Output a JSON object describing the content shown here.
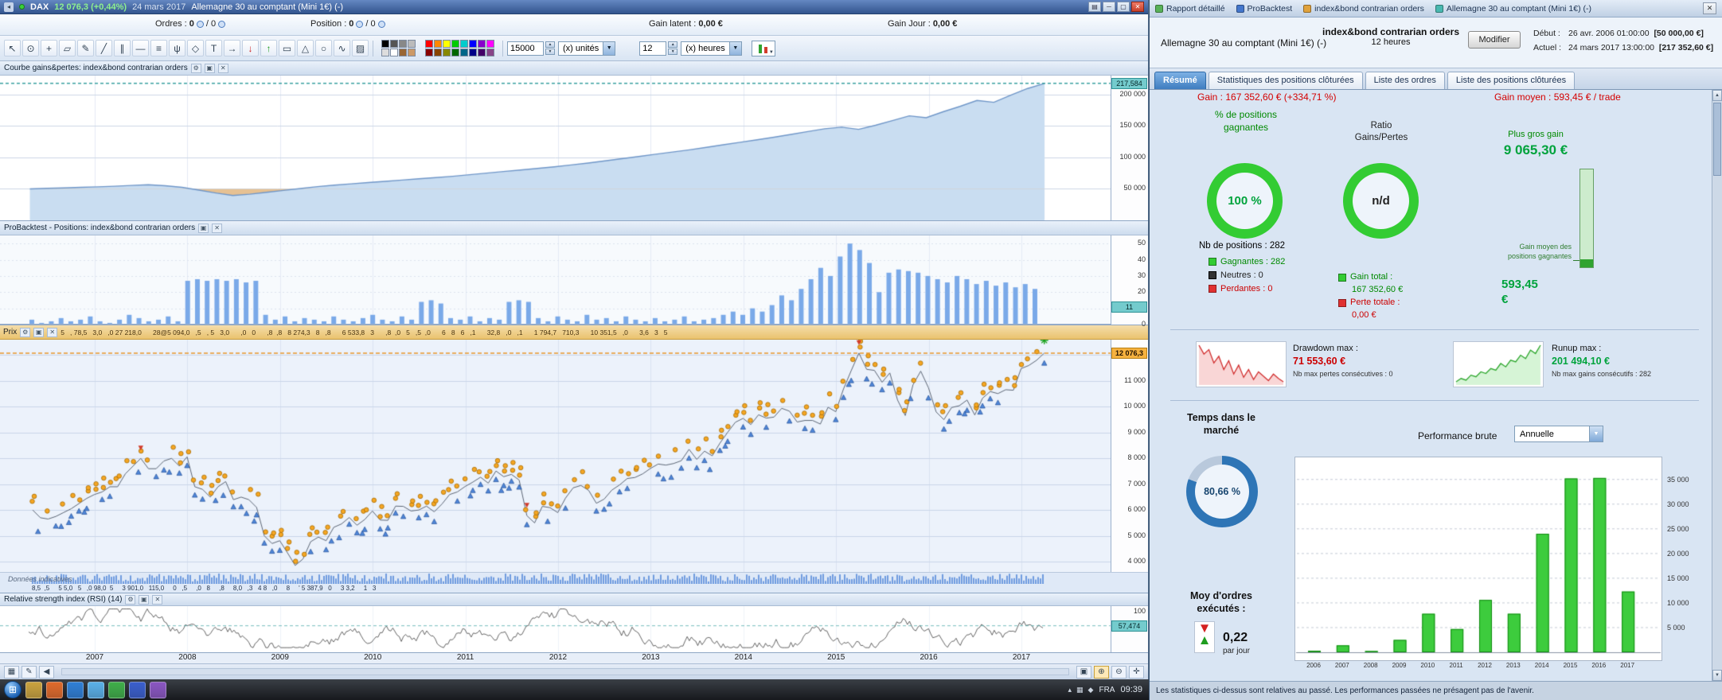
{
  "colors": {
    "equity_fill": "#c9ddf1",
    "equity_line": "#6f96c8",
    "equity_dip_fill": "#e6c193",
    "bar_blue": "#7aa9e8",
    "price_line": "#5c6675",
    "marker_orange": "#f5a623",
    "marker_blue": "#4f86d8",
    "perf_bar_fill": "#3dcc3d",
    "perf_bar_edge": "#0f8a0f",
    "donut_green": "#33cc33",
    "donut_blue": "#2e75b6",
    "teal_box": "#74cbcd",
    "orange_box": "#f6b23f"
  },
  "chart_window": {
    "title_bar": {
      "symbol": "DAX",
      "price": "12 076,3 (+0,44%)",
      "date": "24 mars 2017",
      "instrument": "Allemagne 30 au comptant (Mini 1€) (-)"
    },
    "info_bar": {
      "orders_label": "Ordres :",
      "orders_a": "0",
      "orders_b": "/ 0",
      "position_label": "Position :",
      "position_a": "0",
      "position_b": "/ 0",
      "gain_latent_label": "Gain latent :",
      "gain_latent_value": "0,00 €",
      "gain_jour_label": "Gain Jour :",
      "gain_jour_value": "0,00 €"
    },
    "toolbar": {
      "icons": [
        {
          "glyph": "↖",
          "name": "cursor-icon"
        },
        {
          "glyph": "⊙",
          "name": "zoom-icon"
        },
        {
          "glyph": "+",
          "name": "crosshair-icon"
        },
        {
          "glyph": "▱",
          "name": "eraser-icon"
        },
        {
          "glyph": "✎",
          "name": "pencil-icon"
        },
        {
          "glyph": "╱",
          "name": "line-icon"
        },
        {
          "glyph": "∥",
          "name": "parallel-lines-icon"
        },
        {
          "glyph": "—",
          "name": "horizontal-line-icon"
        },
        {
          "glyph": "≡",
          "name": "fibonacci-icon"
        },
        {
          "glyph": "ψ",
          "name": "pitchfork-icon"
        },
        {
          "glyph": "◇",
          "name": "channel-icon"
        },
        {
          "glyph": "T",
          "name": "text-icon"
        },
        {
          "glyph": "→",
          "name": "arrow-icon"
        },
        {
          "glyph": "↓",
          "name": "sell-arrow-icon",
          "color": "#cc2222"
        },
        {
          "glyph": "↑",
          "name": "buy-arrow-icon",
          "color": "#1f9d1f"
        },
        {
          "glyph": "▭",
          "name": "rectangle-icon"
        },
        {
          "glyph": "△",
          "name": "triangle-icon"
        },
        {
          "glyph": "○",
          "name": "ellipse-icon"
        },
        {
          "glyph": "∿",
          "name": "wave-icon"
        },
        {
          "glyph": "▨",
          "name": "pattern-icon"
        }
      ],
      "palette_grays": [
        "#000000",
        "#555555",
        "#888888",
        "#bbbbbb",
        "#dddddd",
        "#ffffff",
        "#996633",
        "#cc9966"
      ],
      "palette_colors": [
        "#ff0000",
        "#ff8800",
        "#ffff00",
        "#00cc00",
        "#00cccc",
        "#0000ff",
        "#8800cc",
        "#ff00ff",
        "#880000",
        "#884400",
        "#888800",
        "#006600",
        "#006688",
        "#000088",
        "#440066",
        "#884488"
      ],
      "units_value": "15000",
      "units_label": "(x) unités",
      "period_value": "12",
      "period_label": "(x) heures"
    },
    "equity_panel": {
      "title": "Courbe gains&pertes: index&bond contrarian orders"
    },
    "positions_panel": {
      "title": "ProBacktest - Positions: index&bond contrarian orders"
    },
    "price_panel": {
      "title": "Prix",
      "orders_strip_top": "5   , 78,5   3,0   ,0 27 218,0      28@5 094,0   ,5   , 5   3,0      ,0   0      ,8  ,8   8 274,3   8   ,8      6 533,8   3      ,8  ,0   5   ,5  ,0      6   8   6   ,1      32,8   ,0   ,1      1 794,7   710,3      10 351,5   ,0      3,6   3   5",
      "orders_strip_bottom": "8,5  ,5     5 5,0   5   ,0 98,0  5     3 901,0   115,0     0   ,5     ,0   8     ,8     8,0   ,3   4 8   ,0     8     ' 5 387,9   0     3 3,2     1   3",
      "watermark": "Données indicatives"
    },
    "rsi_panel": {
      "title": "Relative strength index (RSI) (14)"
    },
    "x_axis_years": [
      "2007",
      "2008",
      "2009",
      "2010",
      "2011",
      "2012",
      "2013",
      "2014",
      "2015",
      "2016",
      "2017"
    ]
  },
  "report_window": {
    "top_tabs": [
      "Rapport détaillé",
      "ProBacktest",
      "index&bond contrarian orders",
      "Allemagne 30 au comptant (Mini 1€) (-)"
    ],
    "top_tab_icon_colors": [
      "#58b158",
      "#4477cc",
      "#e0a23c",
      "#49b8b0"
    ],
    "header": {
      "instrument": "Allemagne 30 au comptant (Mini 1€) (-)",
      "strategy": "index&bond contrarian orders",
      "timeframe": "12 heures",
      "modify_button": "Modifier",
      "start_label": "Début :",
      "start_value": "26 avr. 2006 01:00:00",
      "start_capital": "[50 000,00 €]",
      "current_label": "Actuel :",
      "current_value": "24 mars 2017 13:00:00",
      "current_capital": "[217 352,60 €]"
    },
    "tabs": [
      "Résumé",
      "Statistiques des positions clôturées",
      "Liste des ordres",
      "Liste des positions clôturées"
    ],
    "summary": {
      "gain_line": "Gain : 167 352,60 € (+334,71 %)",
      "gain_moyen_line": "Gain moyen : 593,45 € / trade",
      "pct_label": "% de positions gagnantes",
      "pct_value": "100 %",
      "ratio_label": "Ratio Gains/Pertes",
      "ratio_value": "n/d",
      "biggest_gain_label": "Plus gros gain",
      "biggest_gain_value": "9 065,30 €",
      "avg_gain_note": "Gain moyen des positions gagnantes",
      "avg_gain_value": "593,45 €",
      "nb_positions": "Nb de positions : 282",
      "winners": "Gagnantes : 282",
      "neutral": "Neutres : 0",
      "losers": "Perdantes : 0",
      "gain_total_label": "Gain total :",
      "gain_total_value": "167 352,60 €",
      "loss_total_label": "Perte totale :",
      "loss_total_value": "0,00 €",
      "drawdown_label": "Drawdown max :",
      "drawdown_value": "71 553,60 €",
      "drawdown_note": "Nb max pertes consécutives : 0",
      "runup_label": "Runup max :",
      "runup_value": "201 494,10 €",
      "runup_note": "Nb max gains consécutifs : 282",
      "time_in_market_label": "Temps dans le marché",
      "time_in_market_value": "80,66 %",
      "perf_label": "Performance brute",
      "perf_period": "Annuelle",
      "avg_orders_label": "Moy d'ordres exécutés :",
      "avg_orders_value": "0,22",
      "avg_orders_unit": "par jour"
    },
    "disclaimer": "Les statistiques ci-dessus sont relatives au passé. Les performances passées ne présagent pas de l'avenir."
  },
  "taskbar": {
    "app_colors": [
      "#c9a23e",
      "#e06a2b",
      "#2f7fd6",
      "#5ab0e8",
      "#3fae49",
      "#3a5fcd",
      "#8a56c2"
    ],
    "tray_icons": [
      "▴",
      "▦",
      "◆"
    ],
    "lang": "FRA",
    "clock": "09:39"
  },
  "chart_data": {
    "equity_curve": {
      "type": "area",
      "start_capital": 50000,
      "ylim": [
        0,
        230000
      ],
      "grid_values": [
        200000,
        150000,
        100000,
        50000
      ],
      "grid_labels": [
        "200 000",
        "150 000",
        "100 000",
        "50 000"
      ],
      "current_value": 217584,
      "current_label": "217,584",
      "values": [
        50000,
        50800,
        51500,
        52500,
        53200,
        54200,
        55500,
        56500,
        55000,
        52500,
        48000,
        43500,
        39500,
        41500,
        44500,
        47500,
        50500,
        53500,
        56000,
        58000,
        60000,
        62000,
        64000,
        66000,
        68000,
        70000,
        72500,
        75000,
        77500,
        80000,
        82500,
        85000,
        88000,
        91000,
        94500,
        98000,
        101500,
        105000,
        108500,
        112000,
        116000,
        120000,
        124000,
        128000,
        132000,
        136500,
        141000,
        145500,
        148000,
        144500,
        151000,
        158500,
        166000,
        163000,
        172500,
        181000,
        190500,
        187500,
        199000,
        209500,
        217584
      ]
    },
    "positions_histogram": {
      "type": "bar",
      "ylim": [
        0,
        55
      ],
      "grid_values": [
        50,
        40,
        30,
        20,
        10,
        0
      ],
      "grid_labels": [
        "50",
        "40",
        "30",
        "20",
        "10",
        "0"
      ],
      "current_value": 11,
      "current_label": "11",
      "values": [
        3,
        1,
        2,
        4,
        2,
        3,
        5,
        2,
        1,
        3,
        6,
        4,
        2,
        3,
        5,
        2,
        27,
        28,
        27,
        28,
        27,
        28,
        26,
        27,
        6,
        3,
        5,
        2,
        4,
        3,
        2,
        5,
        3,
        2,
        4,
        6,
        3,
        2,
        5,
        3,
        14,
        15,
        13,
        4,
        3,
        5,
        2,
        4,
        3,
        14,
        15,
        14,
        4,
        2,
        5,
        3,
        2,
        6,
        3,
        4,
        2,
        5,
        3,
        2,
        4,
        2,
        3,
        5,
        2,
        3,
        4,
        6,
        8,
        6,
        10,
        8,
        12,
        18,
        15,
        22,
        28,
        35,
        30,
        42,
        50,
        46,
        38,
        20,
        32,
        34,
        33,
        32,
        30,
        28,
        26,
        30,
        28,
        25,
        27,
        24,
        26,
        23,
        25,
        22
      ]
    },
    "price_series": {
      "type": "line",
      "ylim": [
        3600,
        12600
      ],
      "grid_values": [
        12000,
        11000,
        10000,
        9000,
        8000,
        7000,
        6000,
        5000,
        4000
      ],
      "grid_labels": [
        "",
        "11 000",
        "10 000",
        "9 000",
        "8 000",
        "7 000",
        "6 000",
        "5 000",
        "4 000"
      ],
      "current_value": 12076.3,
      "current_label": "12 076,3",
      "values": [
        6000,
        5700,
        5650,
        5750,
        5900,
        6050,
        6250,
        6450,
        6600,
        6700,
        6900,
        6900,
        7400,
        7700,
        8000,
        7600,
        7600,
        7900,
        8000,
        7700,
        8060,
        6900,
        6800,
        6500,
        6900,
        7100,
        6400,
        6500,
        6400,
        6100,
        5000,
        4700,
        4810,
        4340,
        3850,
        4100,
        4770,
        4950,
        4810,
        5330,
        5460,
        5710,
        5410,
        5630,
        5960,
        5610,
        5600,
        6150,
        6140,
        5960,
        6000,
        6150,
        5930,
        6230,
        6600,
        6700,
        6910,
        7080,
        7270,
        7040,
        7510,
        7290,
        7380,
        7160,
        5780,
        5500,
        6140,
        6090,
        5900,
        6460,
        6860,
        6950,
        6760,
        6260,
        6420,
        6770,
        6970,
        7220,
        7260,
        7400,
        7610,
        7780,
        7740,
        7800,
        7910,
        8350,
        7960,
        8280,
        8100,
        8590,
        9010,
        9400,
        9550,
        9310,
        9690,
        9560,
        9600,
        9940,
        9830,
        9410,
        9470,
        9470,
        9330,
        9980,
        9810,
        10690,
        11400,
        12080,
        11450,
        11410,
        10950,
        11310,
        10260,
        9660,
        10850,
        11380,
        10740,
        9800,
        9500,
        9970,
        10040,
        10260,
        9680,
        10330,
        10590,
        10510,
        10660,
        10640,
        11480,
        11600,
        11800,
        12080
      ]
    },
    "rsi": {
      "type": "line",
      "ylim": [
        0,
        100
      ],
      "grid_values": [
        100
      ],
      "grid_labels": [
        "100"
      ],
      "current_value": 57.474,
      "current_label": "57,474",
      "points": 480,
      "seed": 11
    },
    "drawdown_spark": {
      "type": "line",
      "values": [
        34,
        26,
        30,
        18,
        24,
        12,
        20,
        8,
        16,
        5,
        12,
        3,
        10,
        6,
        2,
        8,
        4,
        1
      ]
    },
    "runup_spark": {
      "type": "line",
      "values": [
        2,
        6,
        4,
        10,
        8,
        14,
        12,
        18,
        16,
        24,
        20,
        28,
        26,
        34,
        30,
        40,
        36,
        46
      ]
    },
    "performance": {
      "type": "bar",
      "title": "Performance brute",
      "categories": [
        "2006",
        "2007",
        "2008",
        "2009",
        "2010",
        "2011",
        "2012",
        "2013",
        "2014",
        "2015",
        "2016",
        "2017"
      ],
      "values": [
        300,
        1400,
        250,
        2500,
        7800,
        4700,
        10600,
        7800,
        24000,
        35200,
        35300,
        12300
      ],
      "ylim": [
        0,
        38500
      ],
      "axis_labels": [
        "35 000",
        "30 000",
        "25 000",
        "20 000",
        "15 000",
        "10 000",
        "5 000"
      ]
    },
    "donuts": {
      "pct": 100,
      "ratio": 100,
      "time": 80.66
    }
  }
}
